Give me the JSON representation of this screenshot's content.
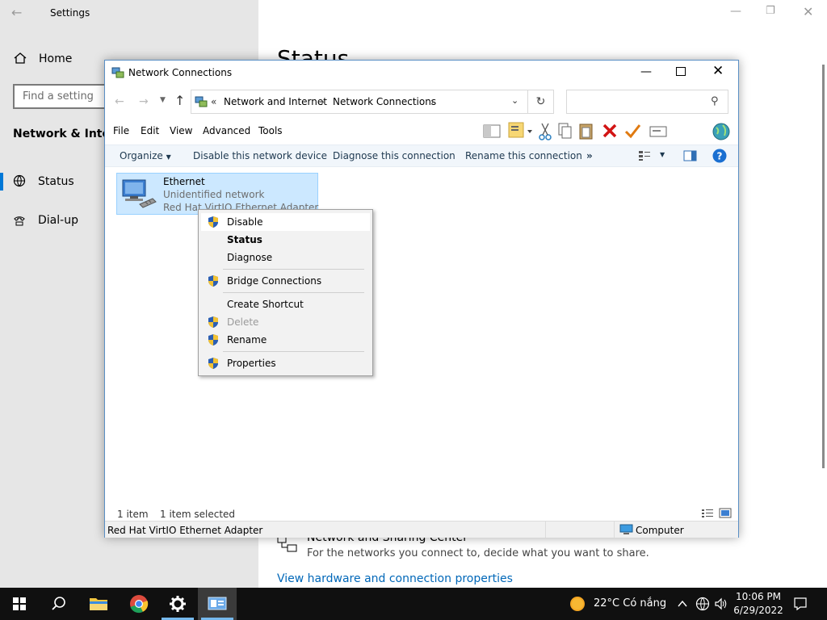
{
  "settings": {
    "title": "Settings",
    "home_label": "Home",
    "find_placeholder": "Find a setting",
    "section_title": "Network & Internet",
    "nav_items": [
      {
        "label": "Status",
        "icon": "globe-icon",
        "selected": true
      },
      {
        "label": "Dial-up",
        "icon": "phone-icon",
        "selected": false
      }
    ],
    "heading": "Status",
    "sharing_center_title": "Network and Sharing Center",
    "sharing_center_desc": "For the networks you connect to, decide what you want to share.",
    "hardware_link": "View hardware and connection properties"
  },
  "explorer": {
    "title": "Network Connections",
    "breadcrumb_overflow": "«",
    "breadcrumb": [
      "Network and Internet",
      "Network Connections"
    ],
    "search_placeholder": "",
    "menu": [
      "File",
      "Edit",
      "View",
      "Advanced",
      "Tools"
    ],
    "commands": {
      "organize": "Organize",
      "disable": "Disable this network device",
      "diagnose": "Diagnose this connection",
      "rename": "Rename this connection",
      "more": "»"
    },
    "item": {
      "name": "Ethernet",
      "status": "Unidentified network",
      "adapter": "Red Hat VirtIO Ethernet Adapter"
    },
    "status_bar": {
      "count": "1 item",
      "selected": "1 item selected"
    },
    "details_bar": {
      "adapter": "Red Hat VirtIO Ethernet Adapter",
      "location": "Computer"
    }
  },
  "context_menu": {
    "items": [
      {
        "label": "Disable",
        "shield": true,
        "state": "highlighted"
      },
      {
        "label": "Status",
        "shield": false,
        "state": "default"
      },
      {
        "label": "Diagnose",
        "shield": false,
        "state": "normal"
      },
      {
        "label": "Bridge Connections",
        "shield": true,
        "state": "normal"
      },
      {
        "label": "Create Shortcut",
        "shield": false,
        "state": "normal"
      },
      {
        "label": "Delete",
        "shield": true,
        "state": "disabled"
      },
      {
        "label": "Rename",
        "shield": true,
        "state": "normal"
      },
      {
        "label": "Properties",
        "shield": true,
        "state": "normal"
      }
    ]
  },
  "taskbar": {
    "apps": [
      "windows-start-icon",
      "search-icon",
      "file-explorer-icon",
      "chrome-icon",
      "settings-gear-icon",
      "network-connections-icon"
    ],
    "weather": "22°C  Có nắng",
    "time": "10:06 PM",
    "date": "6/29/2022"
  },
  "colors": {
    "accent": "#0078d7",
    "selection": "#cce8ff",
    "link": "#0067b8",
    "taskbar": "#101010"
  }
}
